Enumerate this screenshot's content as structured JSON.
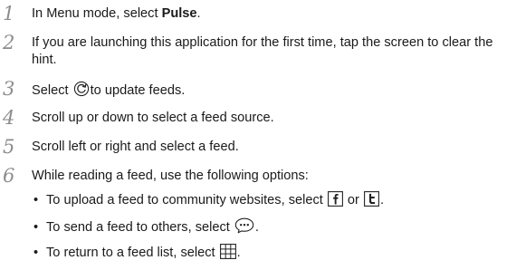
{
  "steps": [
    {
      "num": "1",
      "pre": "In Menu mode, select ",
      "bold": "Pulse",
      "post": "."
    },
    {
      "num": "2",
      "text": "If you are launching this application for the first time, tap the screen to clear the hint."
    },
    {
      "num": "3",
      "pre": "Select ",
      "icon": "refresh-icon",
      "post": "to update feeds."
    },
    {
      "num": "4",
      "text": "Scroll up or down to select a feed source."
    },
    {
      "num": "5",
      "text": "Scroll left or right and select a feed."
    },
    {
      "num": "6",
      "text": "While reading a feed, use the following options:"
    }
  ],
  "bullets": [
    {
      "dot": "•",
      "pre": "To upload a feed to community websites, select ",
      "icon1": "facebook-icon",
      "mid": " or ",
      "icon2": "twitter-icon",
      "post": "."
    },
    {
      "dot": "•",
      "pre": "To send a feed to others, select ",
      "icon": "share-message-icon",
      "post": "."
    },
    {
      "dot": "•",
      "pre": "To return to a feed list, select ",
      "icon": "grid-list-icon",
      "post": "."
    }
  ]
}
